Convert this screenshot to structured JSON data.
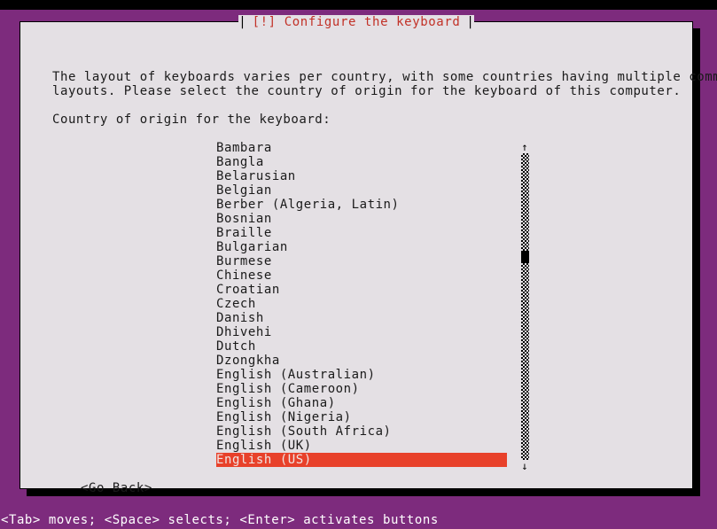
{
  "window": {
    "title": "[!] Configure the keyboard",
    "title_separator": "|"
  },
  "colors": {
    "backdrop_purple": "#7d2b7d",
    "dialog_background": "#e4e0e4",
    "title_red": "#c23127",
    "selection_red": "#e8412a",
    "text_black": "#1a1a1a",
    "status_bar_text": "#ffffff"
  },
  "body": {
    "paragraph_line_1": "The layout of keyboards varies per country, with some countries having multiple common",
    "paragraph_line_2": "layouts. Please select the country of origin for the keyboard of this computer.",
    "prompt_label": "Country of origin for the keyboard:"
  },
  "list": {
    "selected_index": 22,
    "items": [
      "Bambara",
      "Bangla",
      "Belarusian",
      "Belgian",
      "Berber (Algeria, Latin)",
      "Bosnian",
      "Braille",
      "Bulgarian",
      "Burmese",
      "Chinese",
      "Croatian",
      "Czech",
      "Danish",
      "Dhivehi",
      "Dutch",
      "Dzongkha",
      "English (Australian)",
      "English (Cameroon)",
      "English (Ghana)",
      "English (Nigeria)",
      "English (South Africa)",
      "English (UK)",
      "English (US)"
    ]
  },
  "scrollbar": {
    "up_arrow": "↑",
    "down_arrow": "↓",
    "thumb_position_percent": 33
  },
  "buttons": {
    "go_back": "<Go Back>"
  },
  "status_bar": {
    "hint": "<Tab> moves; <Space> selects; <Enter> activates buttons"
  }
}
